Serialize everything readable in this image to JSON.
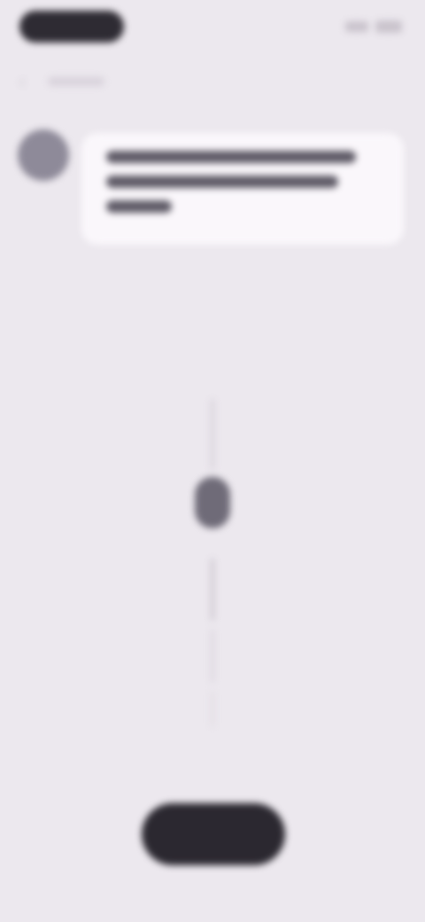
{
  "icons": {
    "back": "arrow-left-icon",
    "avatar": "user-avatar"
  },
  "colors": {
    "background": "#ece8ee",
    "bubble": "#faf7fb",
    "primary_button": "#2b2830",
    "avatar": "#8e8a99"
  },
  "message": {
    "text": ""
  },
  "primary_button": {
    "label": ""
  }
}
